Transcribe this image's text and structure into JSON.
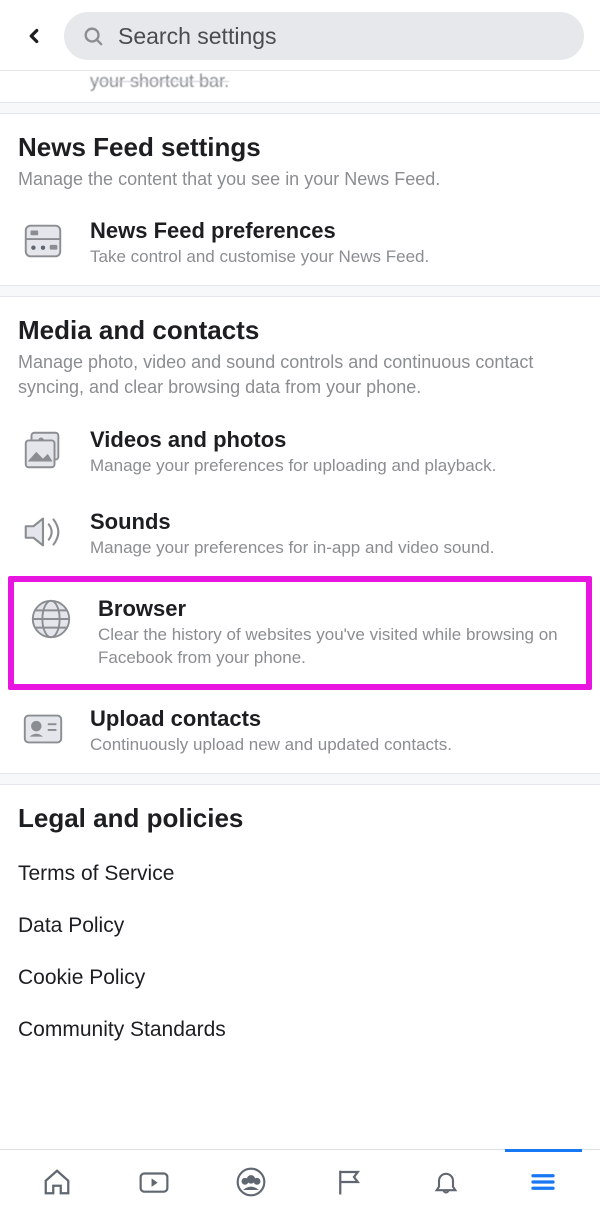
{
  "header": {
    "search_placeholder": "Search settings"
  },
  "stub_text": "your shortcut bar.",
  "sections": {
    "newsfeed": {
      "title": "News Feed settings",
      "desc": "Manage the content that you see in your News Feed.",
      "items": [
        {
          "title": "News Feed preferences",
          "desc": "Take control and customise your News Feed."
        }
      ]
    },
    "media": {
      "title": "Media and contacts",
      "desc": "Manage photo, video and sound controls and continuous contact syncing, and clear browsing data from your phone.",
      "items": [
        {
          "title": "Videos and photos",
          "desc": "Manage your preferences for uploading and playback."
        },
        {
          "title": "Sounds",
          "desc": "Manage your preferences for in-app and video sound."
        },
        {
          "title": "Browser",
          "desc": "Clear the history of websites you've visited while browsing on Facebook from your phone."
        },
        {
          "title": "Upload contacts",
          "desc": "Continuously upload new and updated contacts."
        }
      ]
    },
    "legal": {
      "title": "Legal and policies",
      "links": [
        "Terms of Service",
        "Data Policy",
        "Cookie Policy",
        "Community Standards"
      ]
    }
  }
}
